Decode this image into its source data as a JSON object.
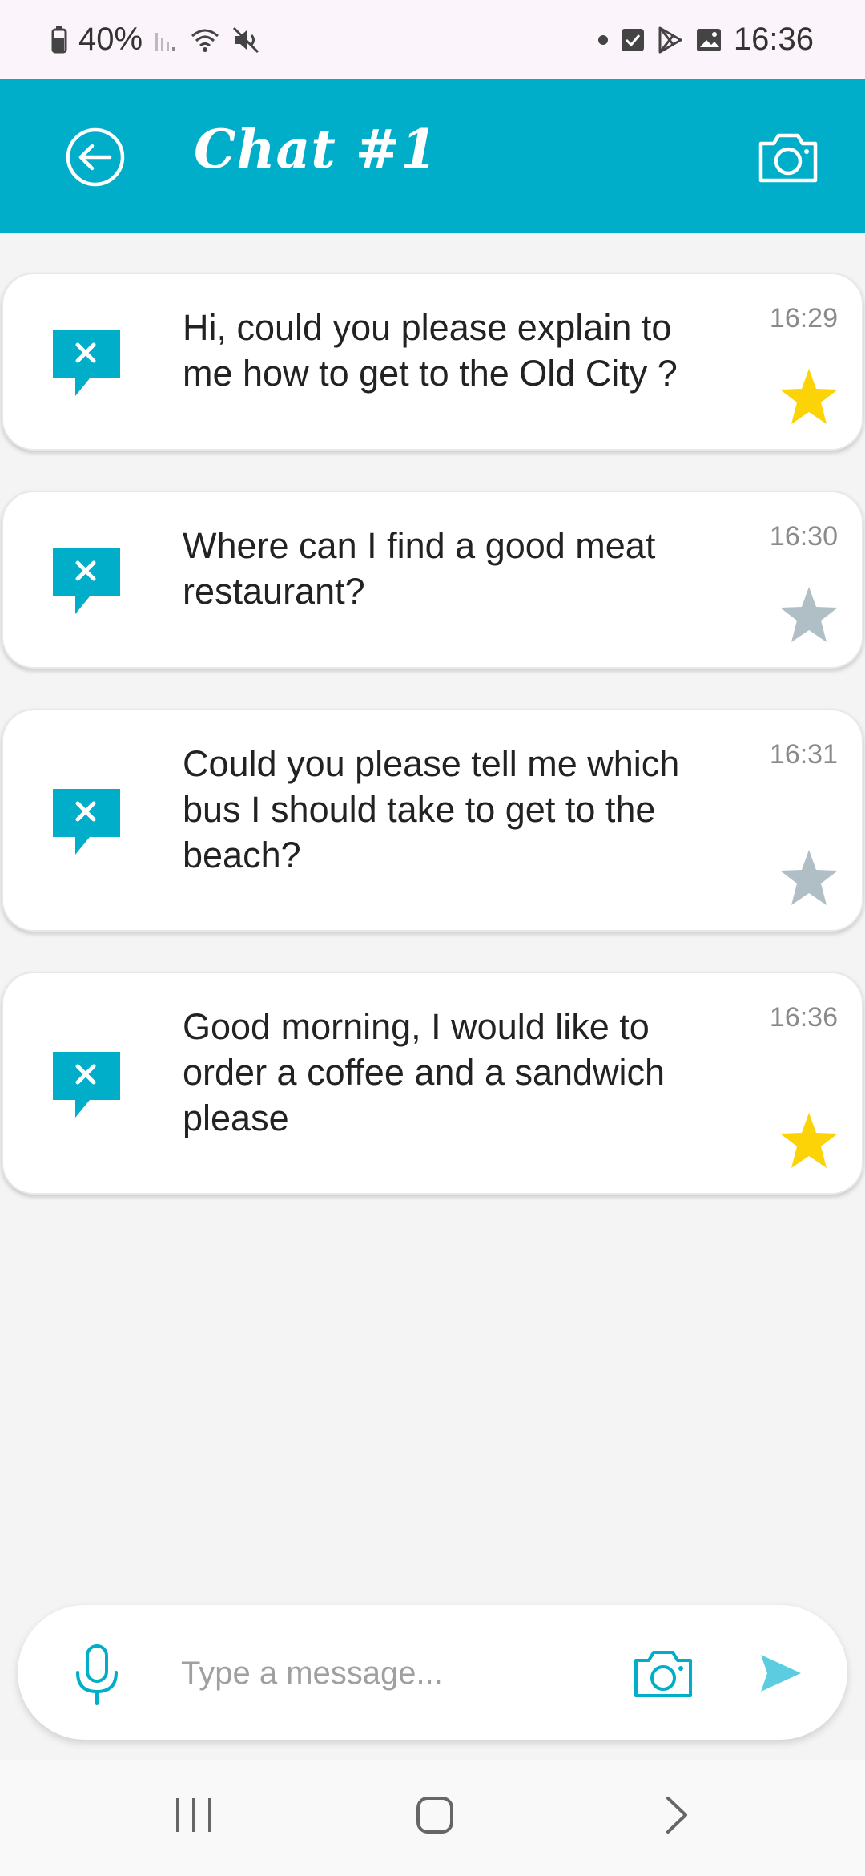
{
  "status_bar": {
    "battery": "40%",
    "time": "16:36"
  },
  "header": {
    "title": "Chat #1"
  },
  "messages": [
    {
      "text": "Hi, could you please explain to me how to get to the Old City ?",
      "time": "16:29",
      "starred": true
    },
    {
      "text": "Where can I find a good meat restaurant?",
      "time": "16:30",
      "starred": false
    },
    {
      "text": "Could you please tell me which bus I should take to get to the beach?",
      "time": "16:31",
      "starred": false
    },
    {
      "text": "Good morning, I would like to order a coffee and a sandwich please",
      "time": "16:36",
      "starred": true
    }
  ],
  "composer": {
    "placeholder": "Type a message..."
  },
  "colors": {
    "accent": "#00aec9",
    "star_active": "#fbd307",
    "star_inactive": "#b0bec5"
  },
  "icons": {
    "back": "back-arrow-icon",
    "camera": "camera-icon",
    "message": "chat-bubble-x-icon",
    "star": "star-icon",
    "mic": "microphone-icon",
    "send": "send-icon"
  }
}
